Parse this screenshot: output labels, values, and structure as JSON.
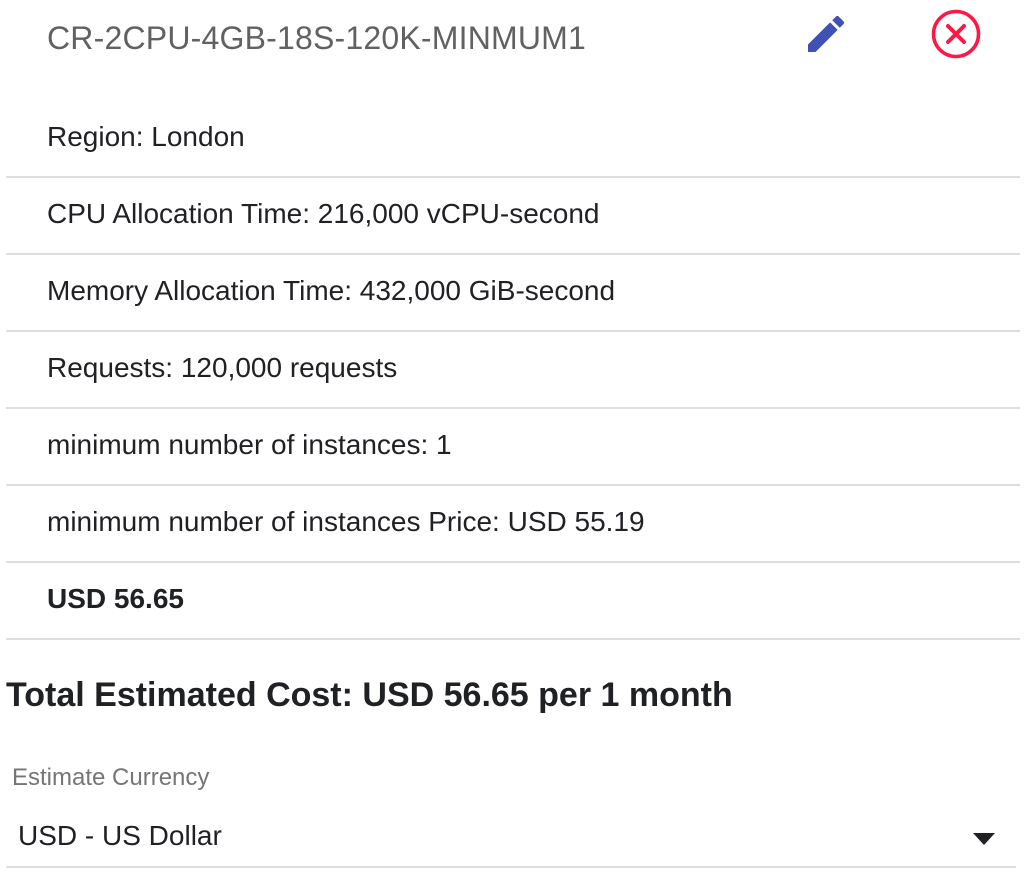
{
  "estimate_item": {
    "title": "CR-2CPU-4GB-18S-120K-MINMUM1",
    "edit_icon": "pencil-icon",
    "delete_icon": "close-circle-icon",
    "edit_icon_color": "#3f51b5",
    "delete_icon_color": "#ff1744",
    "details": [
      {
        "text": "Region: London"
      },
      {
        "text": "CPU Allocation Time: 216,000 vCPU-second"
      },
      {
        "text": "Memory Allocation Time: 432,000 GiB-second"
      },
      {
        "text": "Requests: 120,000 requests"
      },
      {
        "text": "minimum number of instances: 1"
      },
      {
        "text": "minimum number of instances Price: USD 55.19"
      }
    ],
    "item_total": "USD 56.65"
  },
  "total_estimated_cost": "Total Estimated Cost: USD 56.65 per 1 month",
  "currency": {
    "label": "Estimate Currency",
    "selected": "USD - US Dollar"
  }
}
